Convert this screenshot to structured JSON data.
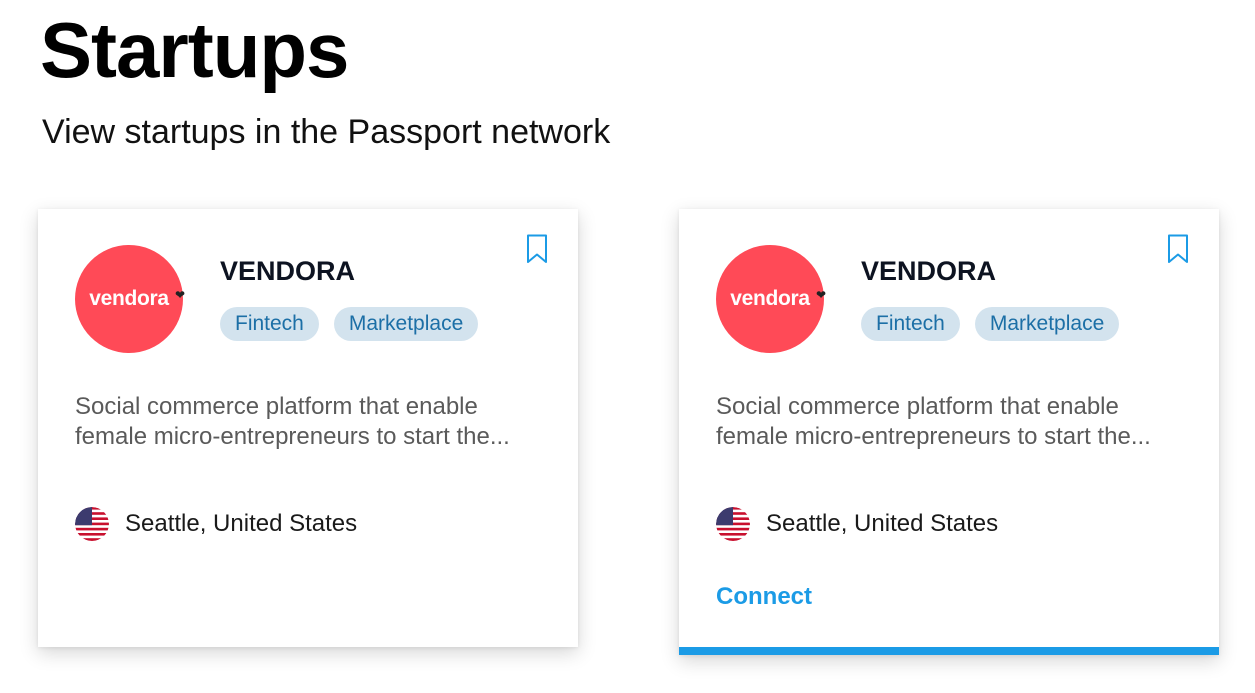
{
  "header": {
    "title": "Startups",
    "subtitle": "View startups in the Passport network"
  },
  "colors": {
    "accent": "#1b9be6",
    "logo_background": "#ff4a57",
    "tag_background": "#d3e3ee",
    "tag_text": "#1c6fa6"
  },
  "cards": [
    {
      "logo_text": "vendora",
      "logo_icon": "heart-icon",
      "name": "VENDORA",
      "tags": [
        "Fintech",
        "Marketplace"
      ],
      "description": "Social commerce platform that enable female micro-entrepreneurs to start the...",
      "location": "Seattle, United States",
      "flag_icon": "us-flag-icon",
      "bookmark_icon": "bookmark-icon"
    },
    {
      "logo_text": "vendora",
      "logo_icon": "heart-icon",
      "name": "VENDORA",
      "tags": [
        "Fintech",
        "Marketplace"
      ],
      "description": "Social commerce platform that enable female micro-entrepreneurs to start the...",
      "location": "Seattle, United States",
      "flag_icon": "us-flag-icon",
      "bookmark_icon": "bookmark-icon",
      "connect_label": "Connect"
    }
  ]
}
